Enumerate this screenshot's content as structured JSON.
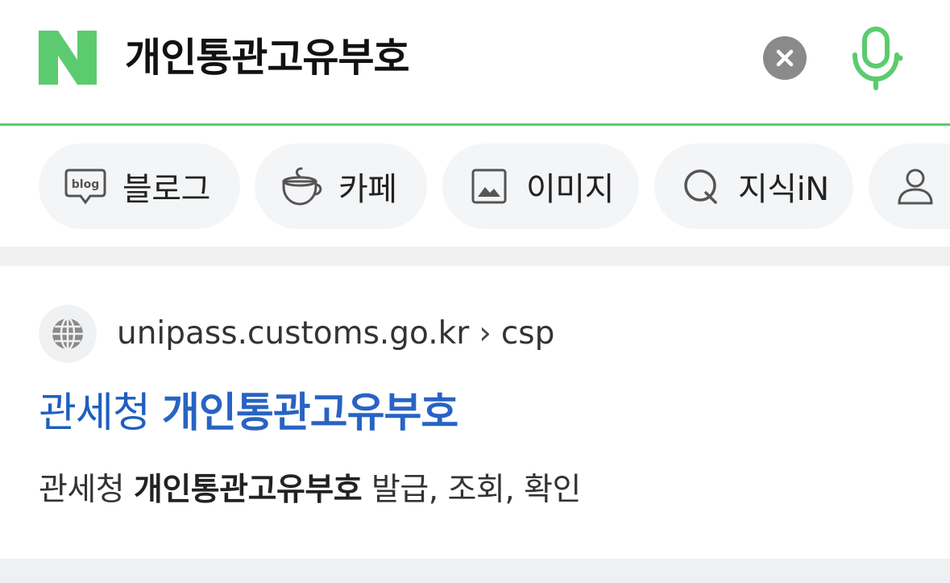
{
  "search": {
    "query": "개인통관고유부호",
    "logo_letter": "N",
    "brand_color": "#5ccb6f"
  },
  "chips": [
    {
      "label": "블로그",
      "icon": "blog-icon",
      "icon_text": "blog"
    },
    {
      "label": "카페",
      "icon": "cup-icon"
    },
    {
      "label": "이미지",
      "icon": "image-icon"
    },
    {
      "label": "지식iN",
      "icon": "q-icon"
    },
    {
      "label": "",
      "icon": "person-icon"
    }
  ],
  "result": {
    "site_domain": "unipass.customs.go.kr",
    "site_separator": "›",
    "site_path": "csp",
    "title_prefix": "관세청",
    "title_highlight": "개인통관고유부호",
    "title_color": "#2863c4",
    "desc_prefix": "관세청",
    "desc_highlight": "개인통관고유부호",
    "desc_suffix": "발급, 조회, 확인"
  }
}
